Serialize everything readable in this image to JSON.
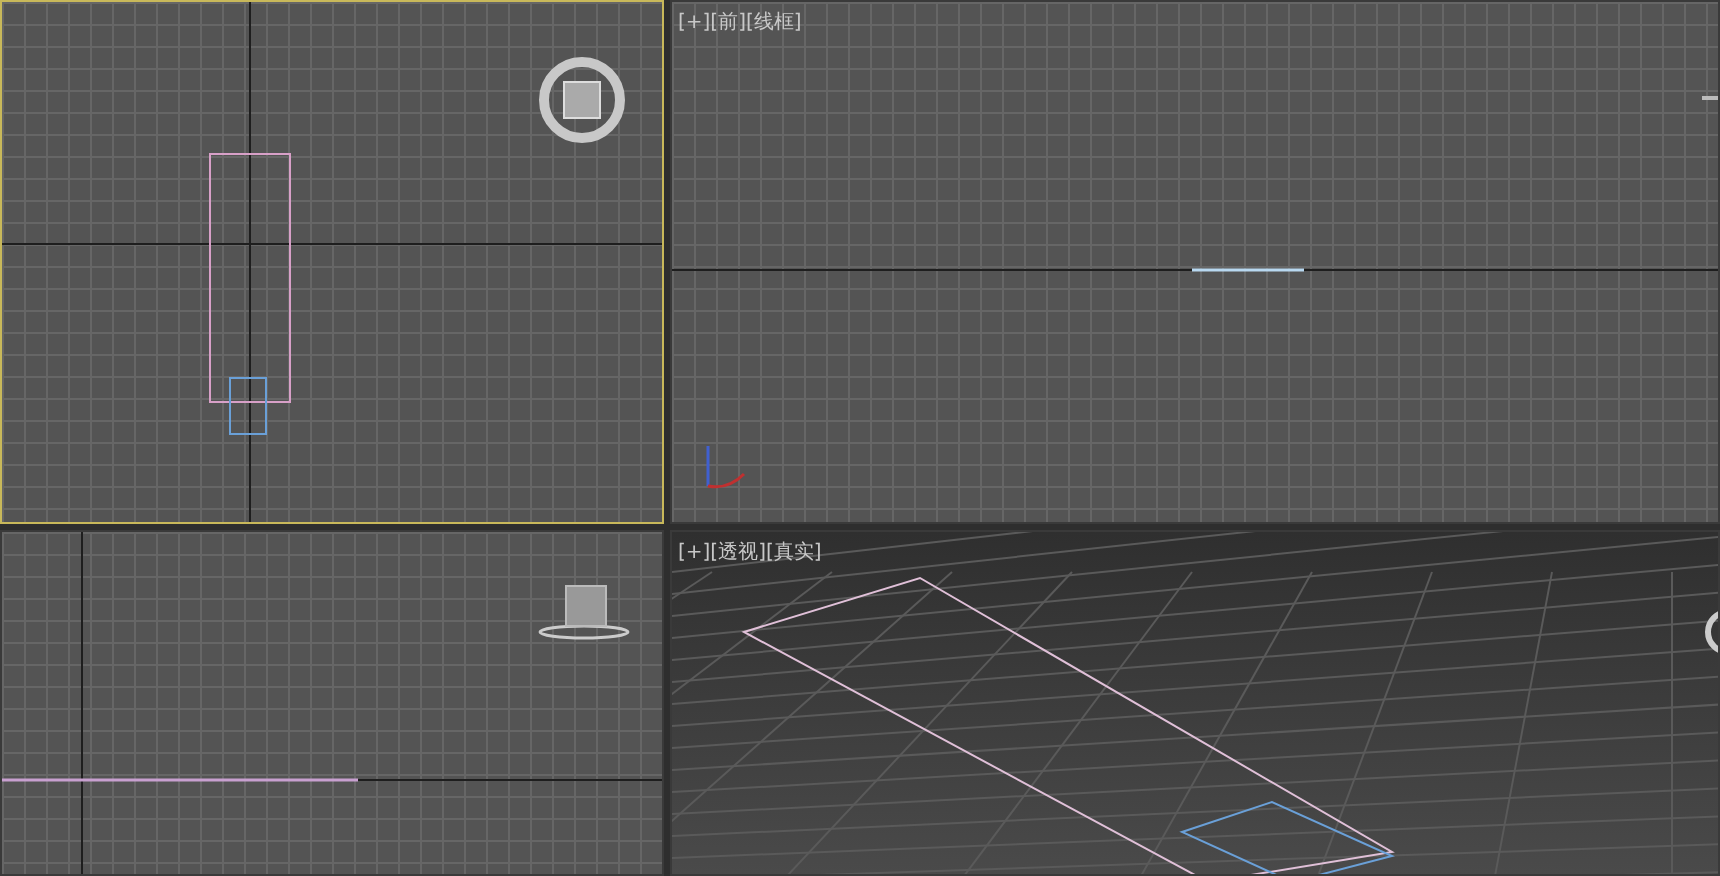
{
  "viewports": [
    {
      "kind": "top",
      "active": true
    },
    {
      "kind": "front",
      "active": false,
      "label": "[+][前][线框]"
    },
    {
      "kind": "left",
      "active": false
    },
    {
      "kind": "perspective",
      "active": false,
      "label": "[+][透视][真实]"
    }
  ]
}
